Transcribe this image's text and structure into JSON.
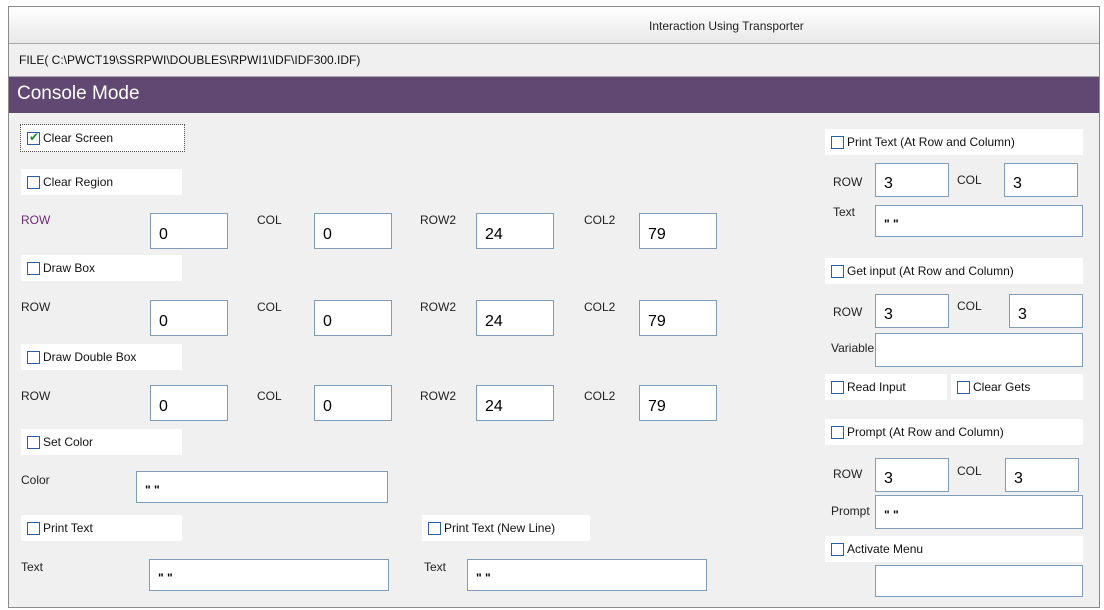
{
  "window": {
    "title": "Interaction Using Transporter"
  },
  "file_path": "FILE( C:\\PWCT19\\SSRPWI\\DOUBLES\\RPWI1\\IDF\\IDF300.IDF)",
  "header": {
    "title": "Console Mode"
  },
  "left": {
    "clear_screen": {
      "label": "Clear Screen",
      "checked": true
    },
    "clear_region": {
      "label": "Clear Region",
      "checked": false
    },
    "region_row": {
      "row": "ROW",
      "col": "COL",
      "row2": "ROW2",
      "col2": "COL2",
      "row_val": "0",
      "col_val": "0",
      "row2_val": "24",
      "col2_val": "79"
    },
    "draw_box": {
      "label": "Draw Box",
      "checked": false
    },
    "box_row": {
      "row": "ROW",
      "col": "COL",
      "row2": "ROW2",
      "col2": "COL2",
      "row_val": "0",
      "col_val": "0",
      "row2_val": "24",
      "col2_val": "79"
    },
    "draw_double_box": {
      "label": "Draw Double Box",
      "checked": false
    },
    "dbox_row": {
      "row": "ROW",
      "col": "COL",
      "row2": "ROW2",
      "col2": "COL2",
      "row_val": "0",
      "col_val": "0",
      "row2_val": "24",
      "col2_val": "79"
    },
    "set_color": {
      "label": "Set Color",
      "checked": false
    },
    "color": {
      "label": "Color",
      "value": "\" \""
    },
    "print_text": {
      "label": "Print Text",
      "checked": false
    },
    "print_text_text": {
      "label": "Text",
      "value": "\" \""
    },
    "print_text_newline": {
      "label": "Print Text (New Line)",
      "checked": false
    },
    "print_text_newline_text": {
      "label": "Text",
      "value": "\" \""
    }
  },
  "right": {
    "print_text_at": {
      "label": "Print Text (At Row and Column)",
      "checked": false
    },
    "print_at_row": {
      "row": "ROW",
      "col": "COL",
      "row_val": "3",
      "col_val": "3"
    },
    "print_at_text": {
      "label": "Text",
      "value": "\" \""
    },
    "get_input": {
      "label": "Get input (At Row and Column)",
      "checked": false
    },
    "get_row": {
      "row": "ROW",
      "col": "COL",
      "row_val": "3",
      "col_val": "3"
    },
    "variable": {
      "label": "Variable",
      "value": ""
    },
    "read_input": {
      "label": "Read Input",
      "checked": false
    },
    "clear_gets": {
      "label": "Clear Gets",
      "checked": false
    },
    "prompt_at": {
      "label": "Prompt (At Row and Column)",
      "checked": false
    },
    "prompt_row": {
      "row": "ROW",
      "col": "COL",
      "row_val": "3",
      "col_val": "3"
    },
    "prompt": {
      "label": "Prompt",
      "value": "\" \""
    },
    "activate_menu": {
      "label": "Activate Menu",
      "checked": false
    },
    "activate_menu_value": ""
  }
}
